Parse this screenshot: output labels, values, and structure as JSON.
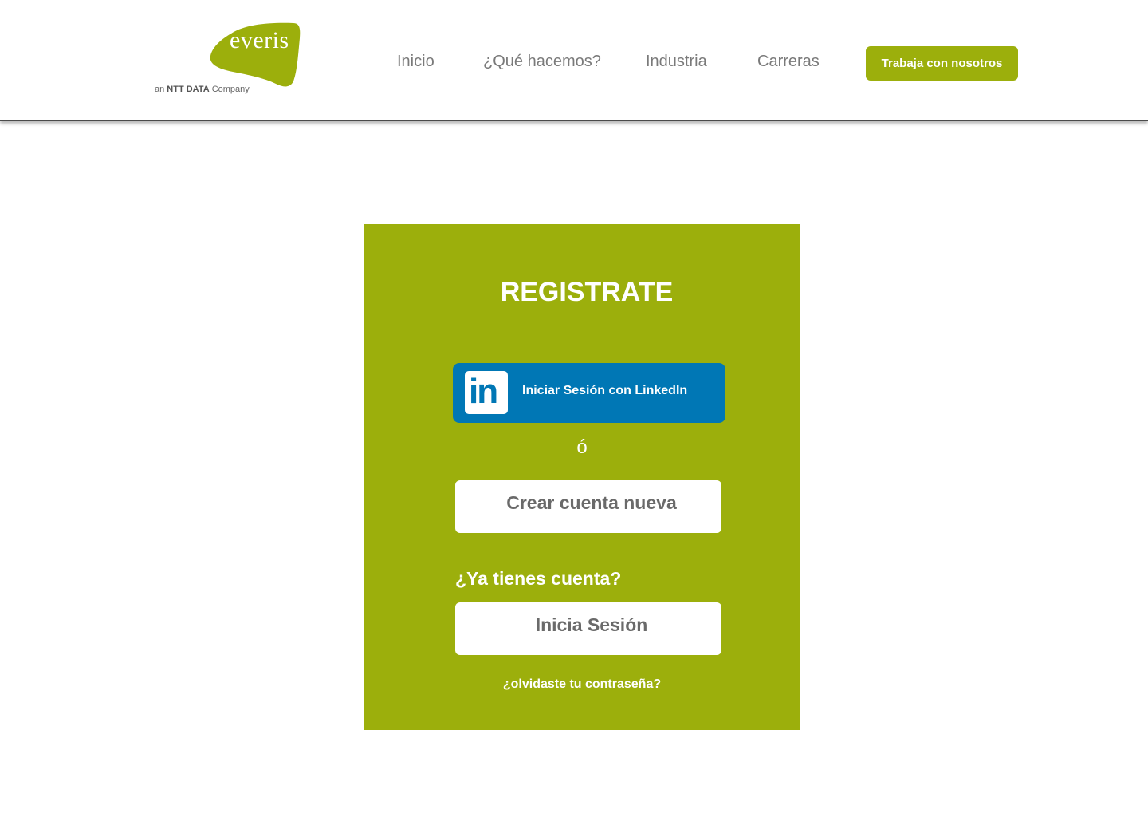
{
  "brand": {
    "logo_word": "everis",
    "tagline_prefix": "an ",
    "tagline_bold": "NTT DATA",
    "tagline_suffix": " Company",
    "accent_color": "#9caf0c",
    "linkedin_color": "#0077b5"
  },
  "nav": {
    "items": [
      {
        "label": "Inicio"
      },
      {
        "label": "¿Qué hacemos?"
      },
      {
        "label": "Industria"
      },
      {
        "label": "Carreras"
      }
    ],
    "cta_label": "Trabaja con nosotros"
  },
  "card": {
    "title": "REGISTRATE",
    "linkedin": {
      "icon_text": "in",
      "label": "Iniciar Sesión con LinkedIn"
    },
    "or_text": "ó",
    "create_account_label": "Crear cuenta nueva",
    "have_account_text": "¿Ya tienes cuenta?",
    "login_label": "Inicia Sesión",
    "forgot_password_label": "¿olvidaste tu contraseña?"
  }
}
